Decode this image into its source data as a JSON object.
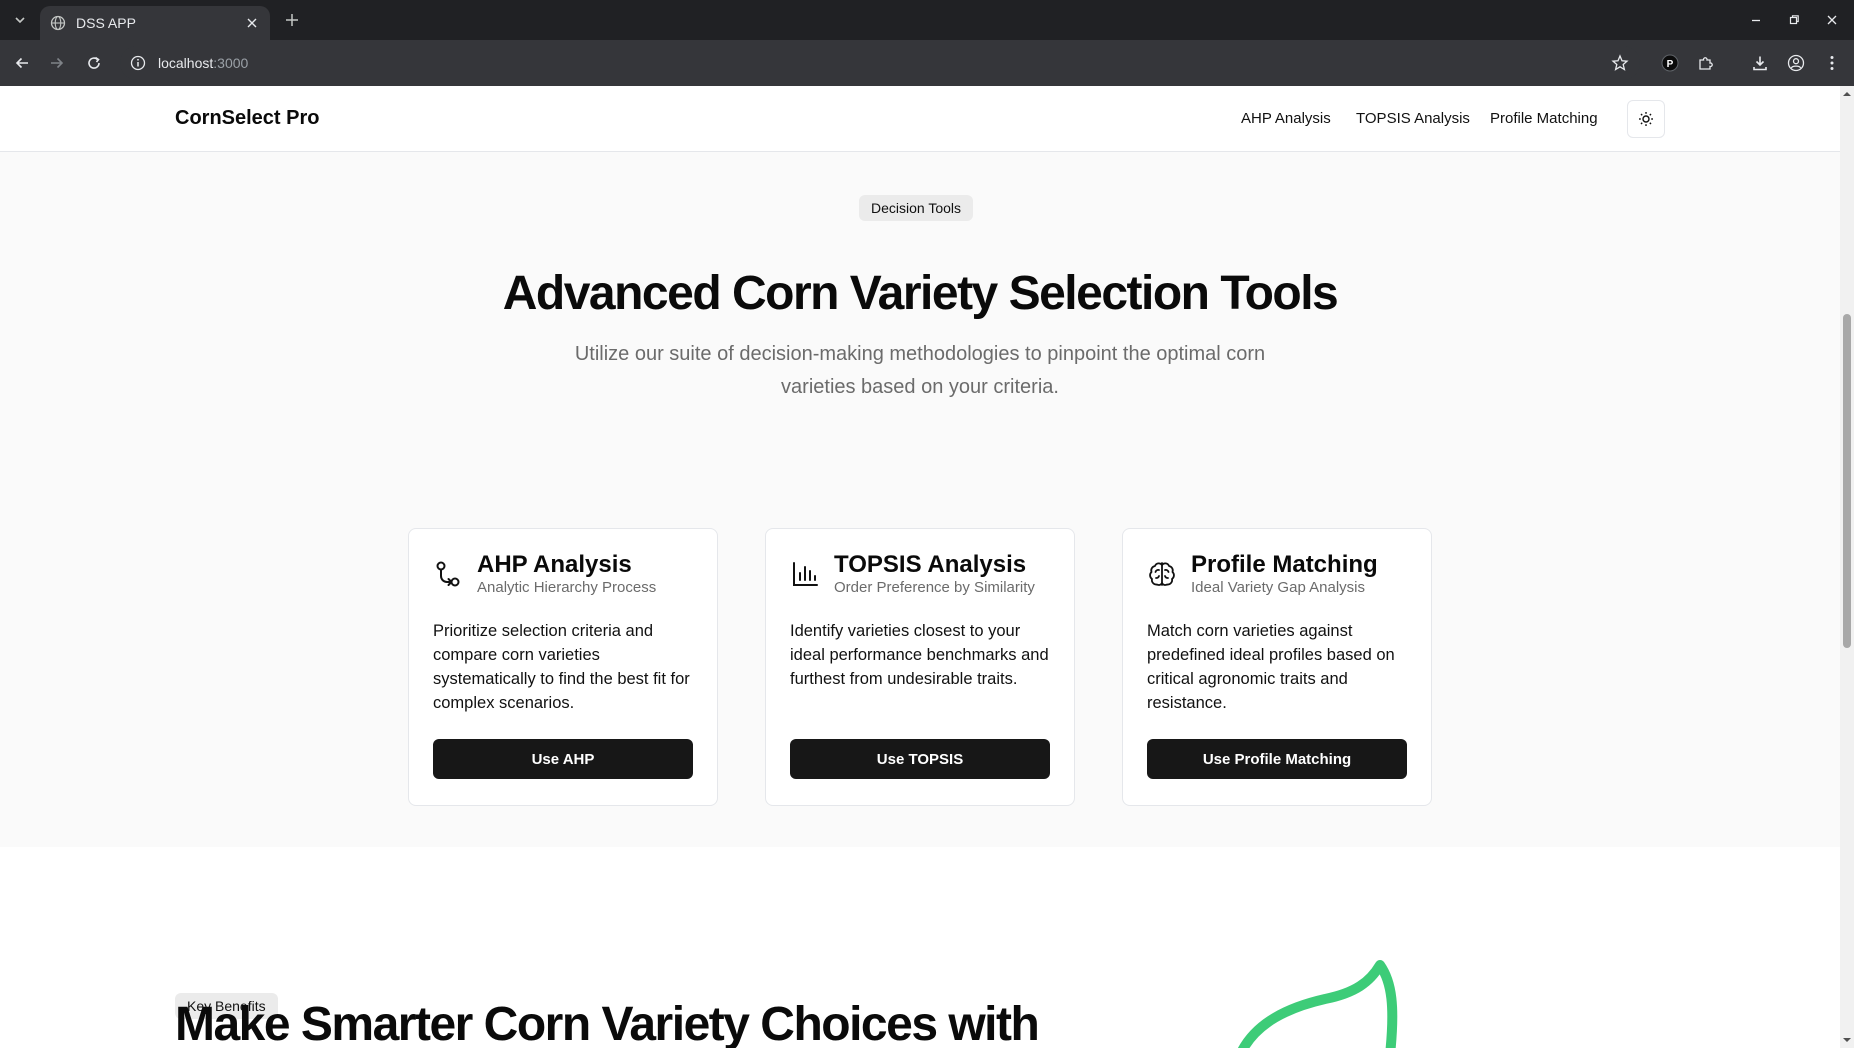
{
  "browser": {
    "tab_title": "DSS APP",
    "url_host": "localhost",
    "url_port": ":3000"
  },
  "header": {
    "brand": "CornSelect Pro",
    "nav": [
      {
        "label": "AHP Analysis"
      },
      {
        "label": "TOPSIS Analysis"
      },
      {
        "label": "Profile Matching"
      }
    ]
  },
  "hero": {
    "badge": "Decision Tools",
    "title": "Advanced Corn Variety Selection Tools",
    "subtitle": "Utilize our suite of decision-making methodologies to pinpoint the optimal corn varieties based on your criteria."
  },
  "cards": [
    {
      "icon": "git-compare-icon",
      "title": "AHP Analysis",
      "subtitle": "Analytic Hierarchy Process",
      "description": "Prioritize selection criteria and compare corn varieties systematically to find the best fit for complex scenarios.",
      "button": "Use AHP"
    },
    {
      "icon": "bar-chart-icon",
      "title": "TOPSIS Analysis",
      "subtitle": "Order Preference by Similarity",
      "description": "Identify varieties closest to your ideal performance benchmarks and furthest from undesirable traits.",
      "button": "Use TOPSIS"
    },
    {
      "icon": "brain-icon",
      "title": "Profile Matching",
      "subtitle": "Ideal Variety Gap Analysis",
      "description": "Match corn varieties against predefined ideal profiles based on critical agronomic traits and resistance.",
      "button": "Use Profile Matching"
    }
  ],
  "benefits": {
    "badge": "Key Benefits",
    "heading": "Make Smarter Corn Variety Choices with"
  },
  "colors": {
    "accent_green": "#3dcc78",
    "button_dark": "#171717"
  }
}
